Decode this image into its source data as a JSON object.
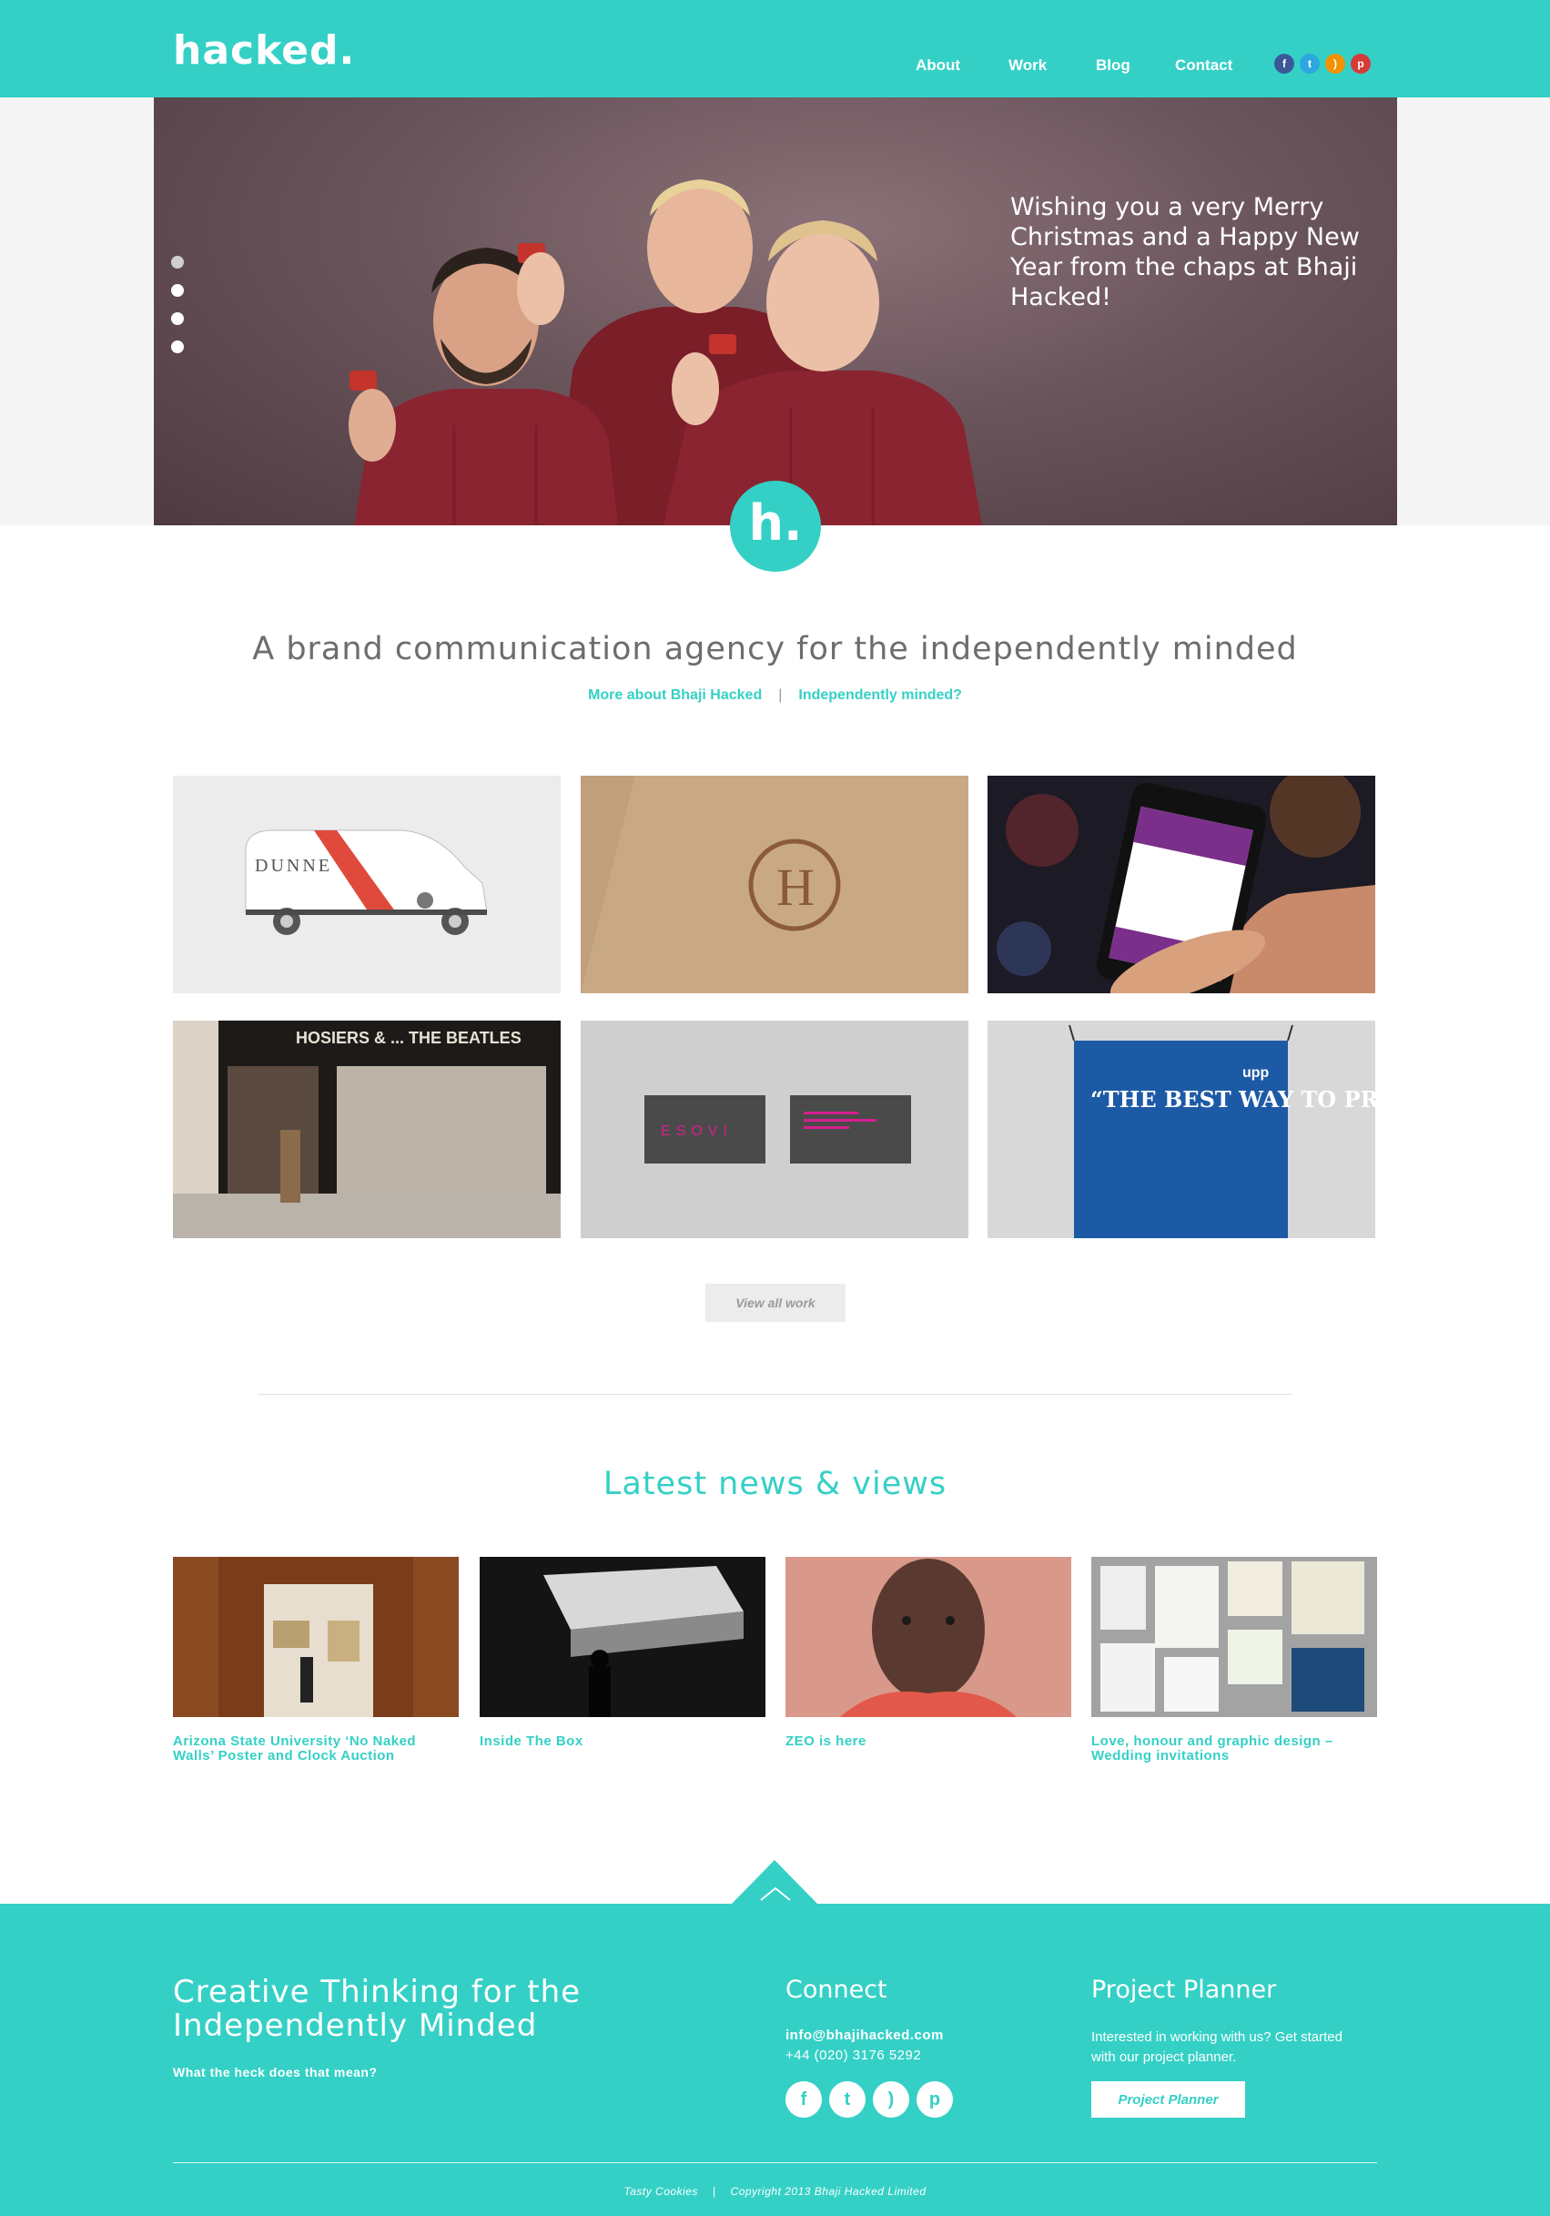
{
  "brand": {
    "logo": "hacked.",
    "accent": "#34d0c6"
  },
  "nav": {
    "items": [
      "About",
      "Work",
      "Blog",
      "Contact"
    ]
  },
  "social_top": [
    {
      "icon": "facebook-icon",
      "glyph": "f",
      "color": "#3b5998"
    },
    {
      "icon": "twitter-icon",
      "glyph": "t",
      "color": "#2ca7e0"
    },
    {
      "icon": "rss-icon",
      "glyph": "r",
      "color": "#f39200"
    },
    {
      "icon": "pinterest-icon",
      "glyph": "p",
      "color": "#d63a3a"
    }
  ],
  "hero": {
    "message": "Wishing you a very Merry Christmas and a Happy New Year from the chaps at Bhaji Hacked!",
    "slide_count": 4,
    "active_slide": 1,
    "badge": "h."
  },
  "intro": {
    "title": "A brand communication agency for the independently minded",
    "link1": "More about Bhaji Hacked",
    "sep": "|",
    "link2": "Independently minded?"
  },
  "work": {
    "tiles": [
      {
        "label": "DUNNE"
      },
      {
        "label": "H"
      },
      {
        "label": ""
      },
      {
        "label": "HOSIERS & ... THE BEATLES"
      },
      {
        "label": "ESOVI"
      },
      {
        "label": "“THE BEST WAY TO PREDICT THE FUTURE"
      }
    ],
    "view_all": "View all work"
  },
  "news": {
    "title": "Latest news & views",
    "items": [
      {
        "caption": "Arizona State University ‘No Naked Walls’ Poster and Clock Auction"
      },
      {
        "caption": "Inside The Box"
      },
      {
        "caption": "ZEO is here"
      },
      {
        "caption": "Love, honour and graphic design – Wedding invitations"
      }
    ]
  },
  "footer": {
    "tagline_line1": "Creative Thinking for the",
    "tagline_line2": "Independently Minded",
    "tagline_link": "What the heck does that mean?",
    "connect_title": "Connect",
    "email": "info@bhajihacked.com",
    "phone": "+44 (020) 3176 5292",
    "planner_title": "Project Planner",
    "planner_text": "Interested in working with us? Get started with our project planner.",
    "planner_button": "Project Planner",
    "bottom_left": "Tasty Cookies",
    "bottom_sep": "|",
    "bottom_right": "Copyright 2013 Bhaji Hacked Limited"
  }
}
